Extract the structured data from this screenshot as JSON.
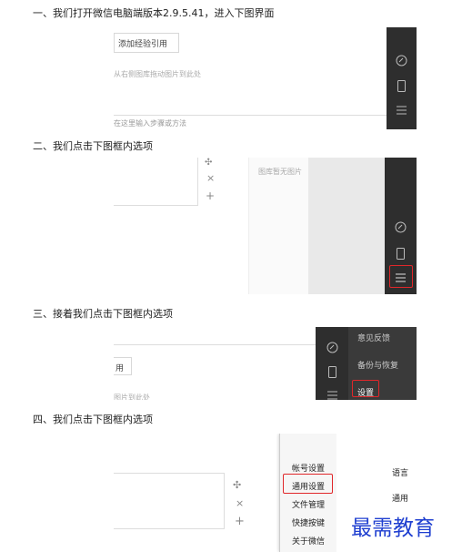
{
  "steps": [
    {
      "title": "一、我们打开微信电脑端版本2.9.5.41，进入下图界面"
    },
    {
      "title": "二、我们点击下图框内选项"
    },
    {
      "title": "三、接着我们点击下图框内选项"
    },
    {
      "title": "四、我们点击下图框内选项"
    }
  ],
  "shot1": {
    "button_label": "添加经验引用",
    "hint": "从右侧图库拖动图片到此处",
    "bottom_hint": "在这里输入步骤或方法"
  },
  "shot2": {
    "library_empty": "图库暂无图片",
    "move_glyph": "✣",
    "close_glyph": "×",
    "add_glyph": "+"
  },
  "shot3": {
    "button_fragment": "用",
    "hint": "图片到此处",
    "menu_items": [
      "意见反馈",
      "备份与恢复",
      "设置"
    ]
  },
  "shot4": {
    "menu_items": [
      "帐号设置",
      "通用设置",
      "文件管理",
      "快捷按键",
      "关于微信"
    ],
    "right_labels": [
      "语言",
      "通用"
    ],
    "move_glyph": "✣",
    "close_glyph": "×",
    "add_glyph": "+"
  },
  "watermark": "最需教育",
  "colors": {
    "highlight": "#e0272a",
    "sidebar": "#2e2e2e",
    "watermark": "#1f3fd0"
  }
}
